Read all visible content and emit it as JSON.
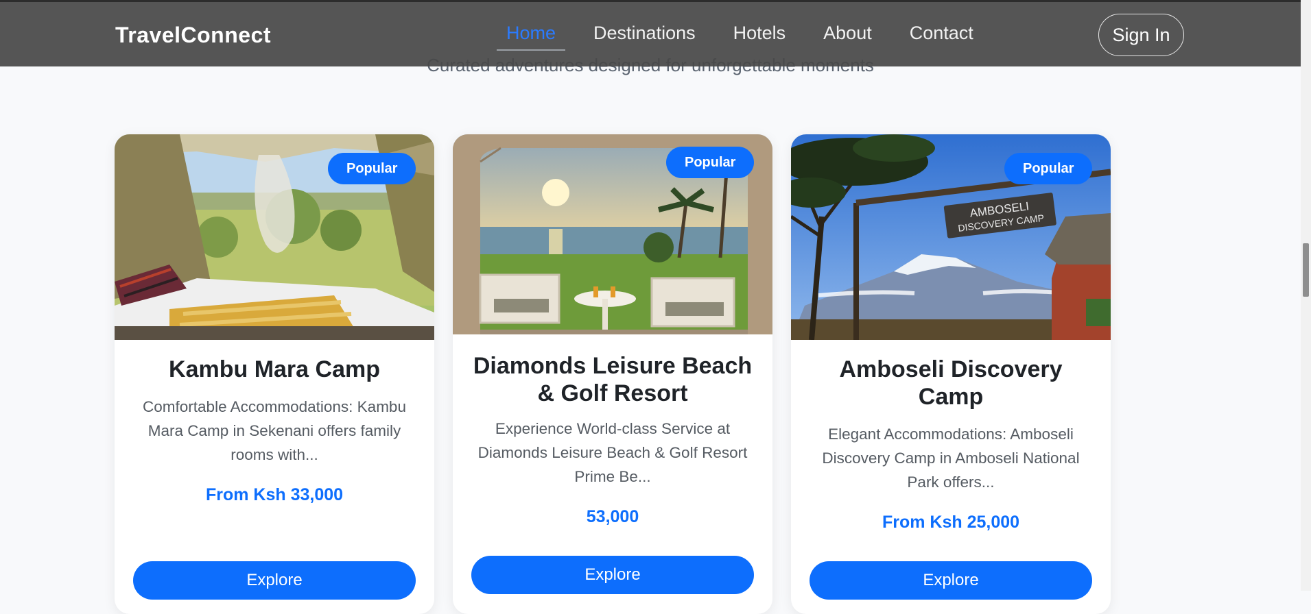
{
  "nav": {
    "brand": "TravelConnect",
    "links": [
      "Home",
      "Destinations",
      "Hotels",
      "About",
      "Contact"
    ],
    "active_link": "Home",
    "sign_in": "Sign In"
  },
  "section": {
    "subtitle": "Curated adventures designed for unforgettable moments"
  },
  "colors": {
    "accent": "#0d6efd",
    "navbar": "#484848",
    "active_link": "#2b7bff"
  },
  "cards": [
    {
      "badge": "Popular",
      "title": "Kambu Mara Camp",
      "description": "Comfortable Accommodations: Kambu Mara Camp in Sekenani offers family rooms with...",
      "price": "From Ksh 33,000",
      "button": "Explore",
      "image_icon": "safari-tent-photo"
    },
    {
      "badge": "Popular",
      "title": "Diamonds Leisure Beach & Golf Resort",
      "description": "Experience World-class Service at Diamonds Leisure Beach & Golf Resort Prime Be...",
      "price": "53,000",
      "button": "Explore",
      "image_icon": "beach-sunset-photo"
    },
    {
      "badge": "Popular",
      "title": "Amboseli Discovery Camp",
      "description": "Elegant Accommodations: Amboseli Discovery Camp in Amboseli National Park offers...",
      "price": "From Ksh 25,000",
      "button": "Explore",
      "image_icon": "kilimanjaro-camp-photo",
      "sign_text": [
        "AMBOSELI",
        "DISCOVERY CAMP"
      ]
    }
  ]
}
